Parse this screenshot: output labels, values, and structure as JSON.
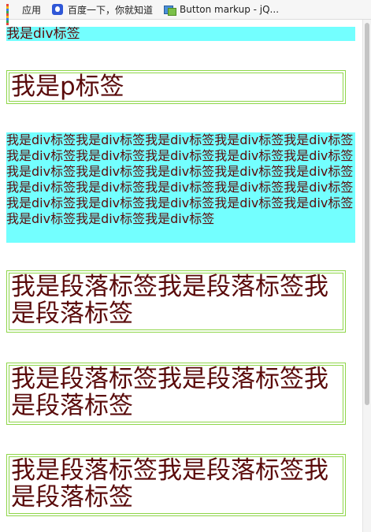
{
  "bookmarks": [
    {
      "label": "应用",
      "icon": "apps-grid-icon"
    },
    {
      "label": "百度一下，你就知道",
      "icon": "baidu-paw-icon"
    },
    {
      "label": "Button markup - jQ...",
      "icon": "button-markup-icon"
    }
  ],
  "colors": {
    "div_background": "#73ffff",
    "text": "#5a0b0b",
    "border": "#8fd64a"
  },
  "content": {
    "div_short": "我是div标签",
    "p_short": "我是p标签",
    "div_long": "我是div标签我是div标签我是div标签我是div标签我是div标签我是div标签我是div标签我是div标签我是div标签我是div标签我是div标签我是div标签我是div标签我是div标签我是div标签我是div标签我是div标签我是div标签我是div标签我是div标签我是div标签我是div标签我是div标签我是div标签我是div标签我是div标签我是div标签我是div标签",
    "paragraphs": [
      "我是段落标签我是段落标签我是段落标签",
      "我是段落标签我是段落标签我是段落标签",
      "我是段落标签我是段落标签我是段落标签"
    ]
  }
}
